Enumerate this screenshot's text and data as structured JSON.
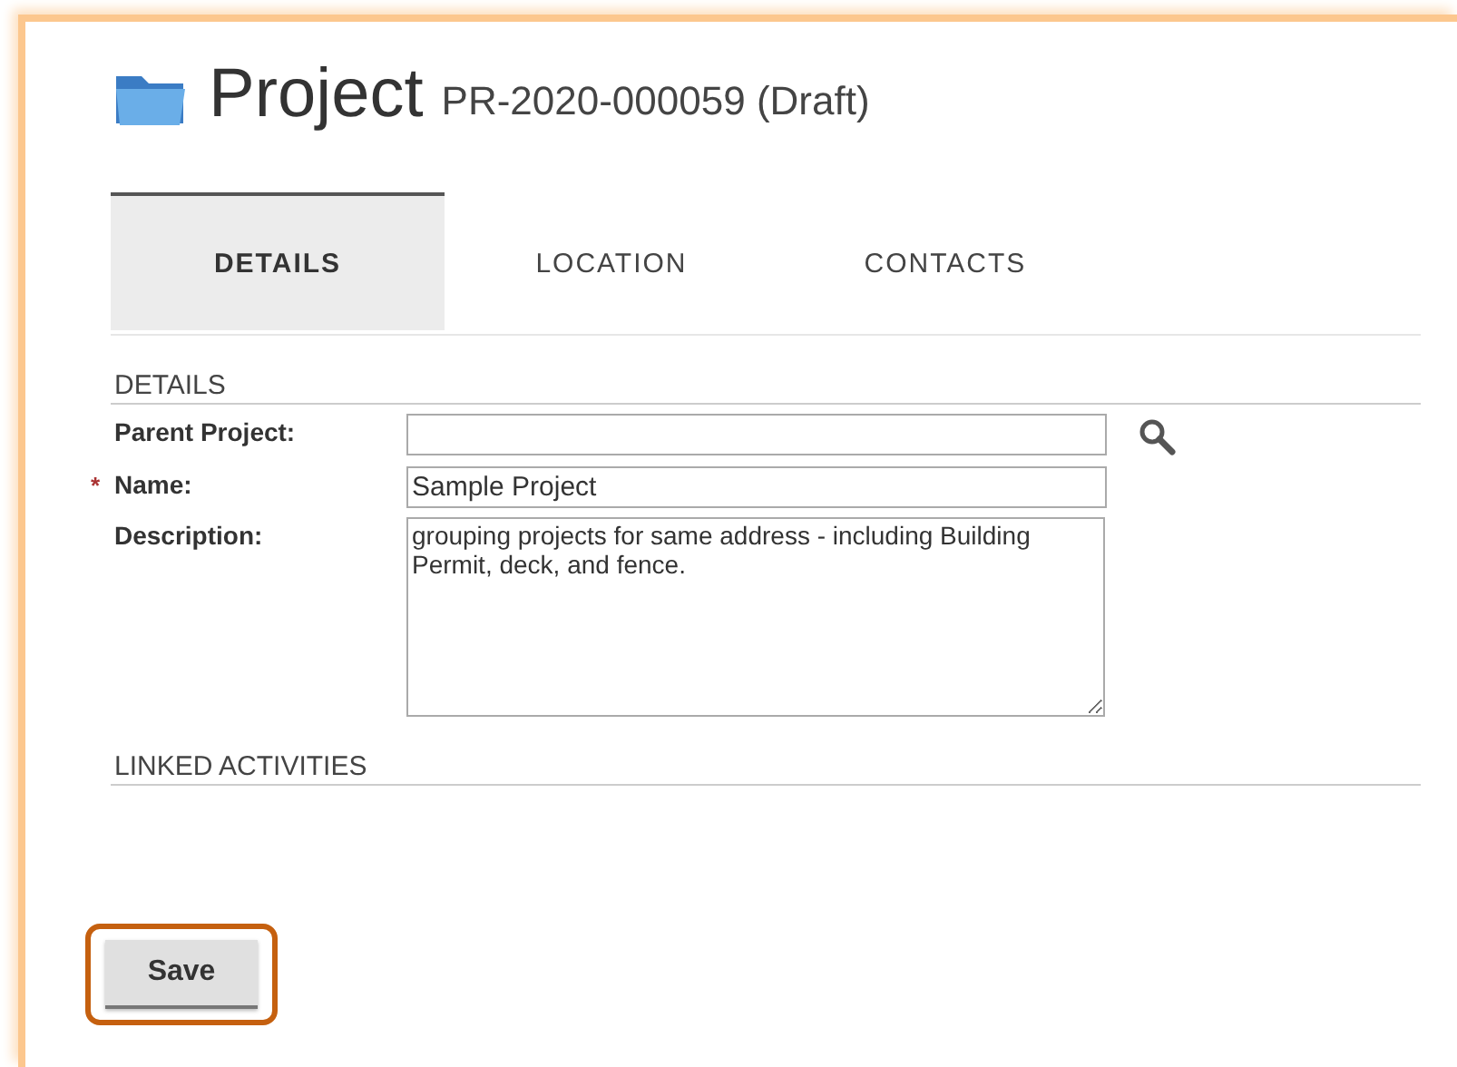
{
  "header": {
    "title": "Project",
    "subtitle": "PR-2020-000059 (Draft)"
  },
  "tabs": [
    {
      "label": "DETAILS",
      "selected": true
    },
    {
      "label": "LOCATION",
      "selected": false
    },
    {
      "label": "CONTACTS",
      "selected": false
    }
  ],
  "sections": [
    {
      "title": "DETAILS",
      "fields": [
        {
          "kind": "lookup",
          "label": "Parent Project:"
        },
        {
          "kind": "text",
          "label": "Name:",
          "required_mark": "*",
          "value": "Sample Project"
        },
        {
          "kind": "textarea",
          "label": "Description:",
          "value": "grouping projects for same address - including Building Permit, deck, and fence."
        }
      ]
    },
    {
      "title": "LINKED ACTIVITIES"
    }
  ],
  "save_button": {
    "label": "Save",
    "highlighted": true
  }
}
